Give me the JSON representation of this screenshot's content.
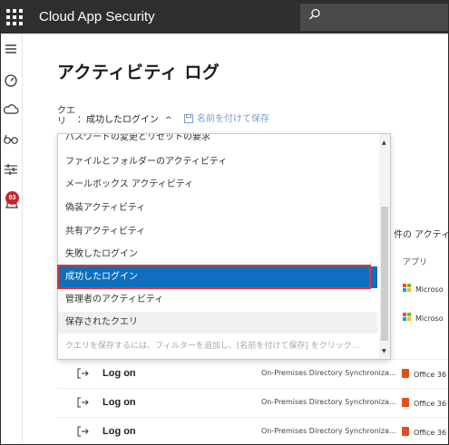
{
  "topbar": {
    "app_title": "Cloud App Security",
    "app_launcher_icon": "waffle-icon",
    "search_icon": "search-icon"
  },
  "rail": {
    "icons": [
      "hamburger-icon",
      "dashboard-icon",
      "cloud-icon",
      "glasses-icon",
      "sliders-icon",
      "alerts-icon"
    ],
    "alerts_badge": "93"
  },
  "page": {
    "title": "アクティビティ ログ"
  },
  "query": {
    "label": "クエリ",
    "value": "：成功したログイン",
    "chevron": "^",
    "save_label": "名前を付けて保存"
  },
  "dropdown": {
    "items": [
      {
        "label": "パスワードの変更とリセットの要求",
        "state": "normal"
      },
      {
        "label": "ファイルとフォルダーのアクティビティ",
        "state": "normal"
      },
      {
        "label": "メールボックス アクティビティ",
        "state": "normal"
      },
      {
        "label": "偽装アクティビティ",
        "state": "normal"
      },
      {
        "label": "共有アクティビティ",
        "state": "normal"
      },
      {
        "label": "失敗したログイン",
        "state": "normal"
      },
      {
        "label": "成功したログイン",
        "state": "selected"
      },
      {
        "label": "管理者のアクティビティ",
        "state": "normal"
      },
      {
        "label": "保存されたクエリ",
        "state": "section"
      },
      {
        "label": "クエリを保存するには、フィルターを追加し、[名前を付けて保存] をクリック...",
        "state": "hint"
      }
    ]
  },
  "table": {
    "count_label": "件の アクティ",
    "app_column_header": "アプリ",
    "partial_app_rows": [
      "Microso",
      "Microso"
    ],
    "rows": [
      {
        "activity": "Log on",
        "source": "On-Premises Directory Synchroniza...",
        "app": "Office 36"
      },
      {
        "activity": "Log on",
        "source": "On-Premises Directory Synchroniza...",
        "app": "Office 36"
      },
      {
        "activity": "Log on",
        "source": "On-Premises Directory Synchroniza...",
        "app": "Office 36"
      }
    ]
  },
  "colors": {
    "topbar": "#2f2f2f",
    "selected": "#106ebe",
    "highlight_outline": "#e0333a",
    "badge": "#c4262e",
    "office": "#e1501c"
  }
}
